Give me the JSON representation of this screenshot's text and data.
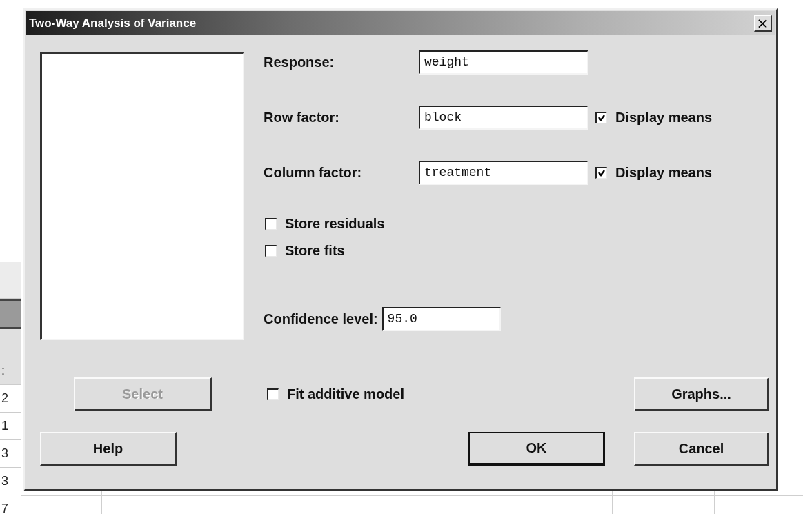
{
  "sheet": {
    "row_numbers": [
      ":",
      "2",
      "1",
      "3",
      "3",
      "7"
    ]
  },
  "window": {
    "title": "Two-Way Analysis of Variance",
    "close": "×"
  },
  "fields": [
    {
      "label": "Response:",
      "value": "weight"
    },
    {
      "label": "Row factor:",
      "value": "block",
      "display_means": {
        "label": "Display means",
        "checked": true
      }
    },
    {
      "label": "Column factor:",
      "value": "treatment",
      "display_means": {
        "label": "Display means",
        "checked": true
      }
    }
  ],
  "store_options": [
    {
      "label": "Store residuals",
      "checked": false
    },
    {
      "label": "Store fits",
      "checked": false
    }
  ],
  "confidence": {
    "label": "Confidence level:",
    "value": "95.0"
  },
  "fit_additive": {
    "label": "Fit additive model",
    "checked": false
  },
  "buttons": [
    {
      "label": "Select",
      "kind": "select",
      "disabled": true
    },
    {
      "label": "Graphs...",
      "kind": "graphs",
      "disabled": false
    },
    {
      "label": "Help",
      "kind": "help",
      "disabled": false
    },
    {
      "label": "OK",
      "kind": "ok",
      "disabled": false,
      "default": true
    },
    {
      "label": "Cancel",
      "kind": "cancel",
      "disabled": false
    }
  ]
}
